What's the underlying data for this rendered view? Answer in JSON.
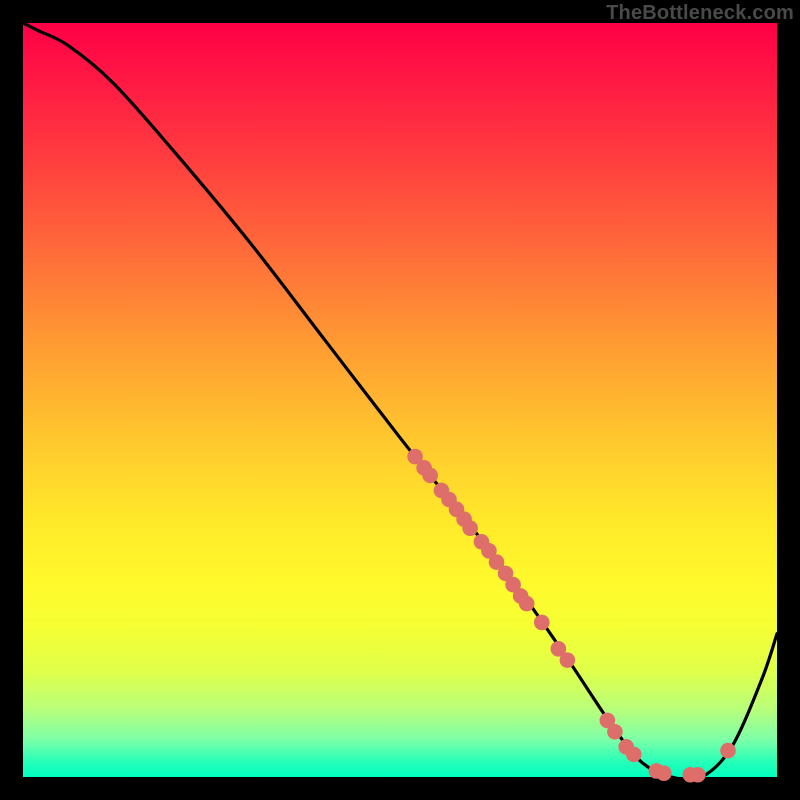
{
  "watermark": "TheBottleneck.com",
  "chart_data": {
    "type": "line",
    "title": "",
    "xlabel": "",
    "ylabel": "",
    "xlim": [
      0,
      100
    ],
    "ylim": [
      0,
      100
    ],
    "series": [
      {
        "name": "bottleneck-curve",
        "x": [
          0,
          2,
          6,
          12,
          20,
          30,
          40,
          50,
          58,
          65,
          72,
          78,
          82,
          86,
          90,
          94,
          98,
          100
        ],
        "values": [
          100,
          99,
          97,
          92,
          83,
          71,
          58,
          45,
          35,
          26,
          16,
          7,
          2,
          0,
          0,
          4,
          13,
          19
        ]
      }
    ],
    "highlighted_points": {
      "name": "data-dots",
      "color": "#de6e6a",
      "points": [
        {
          "x": 52.0,
          "y": 42.5
        },
        {
          "x": 53.2,
          "y": 41.0
        },
        {
          "x": 54.0,
          "y": 40.0
        },
        {
          "x": 55.5,
          "y": 38.0
        },
        {
          "x": 56.5,
          "y": 36.8
        },
        {
          "x": 57.5,
          "y": 35.5
        },
        {
          "x": 58.5,
          "y": 34.2
        },
        {
          "x": 59.3,
          "y": 33.0
        },
        {
          "x": 60.8,
          "y": 31.2
        },
        {
          "x": 61.8,
          "y": 30.0
        },
        {
          "x": 62.8,
          "y": 28.5
        },
        {
          "x": 64.0,
          "y": 27.0
        },
        {
          "x": 65.0,
          "y": 25.5
        },
        {
          "x": 66.0,
          "y": 24.0
        },
        {
          "x": 66.8,
          "y": 23.0
        },
        {
          "x": 68.8,
          "y": 20.5
        },
        {
          "x": 71.0,
          "y": 17.0
        },
        {
          "x": 72.2,
          "y": 15.5
        },
        {
          "x": 77.5,
          "y": 7.5
        },
        {
          "x": 78.5,
          "y": 6.0
        },
        {
          "x": 80.0,
          "y": 4.0
        },
        {
          "x": 81.0,
          "y": 3.0
        },
        {
          "x": 84.0,
          "y": 0.8
        },
        {
          "x": 85.0,
          "y": 0.5
        },
        {
          "x": 88.5,
          "y": 0.3
        },
        {
          "x": 89.5,
          "y": 0.3
        },
        {
          "x": 93.5,
          "y": 3.5
        }
      ]
    }
  }
}
